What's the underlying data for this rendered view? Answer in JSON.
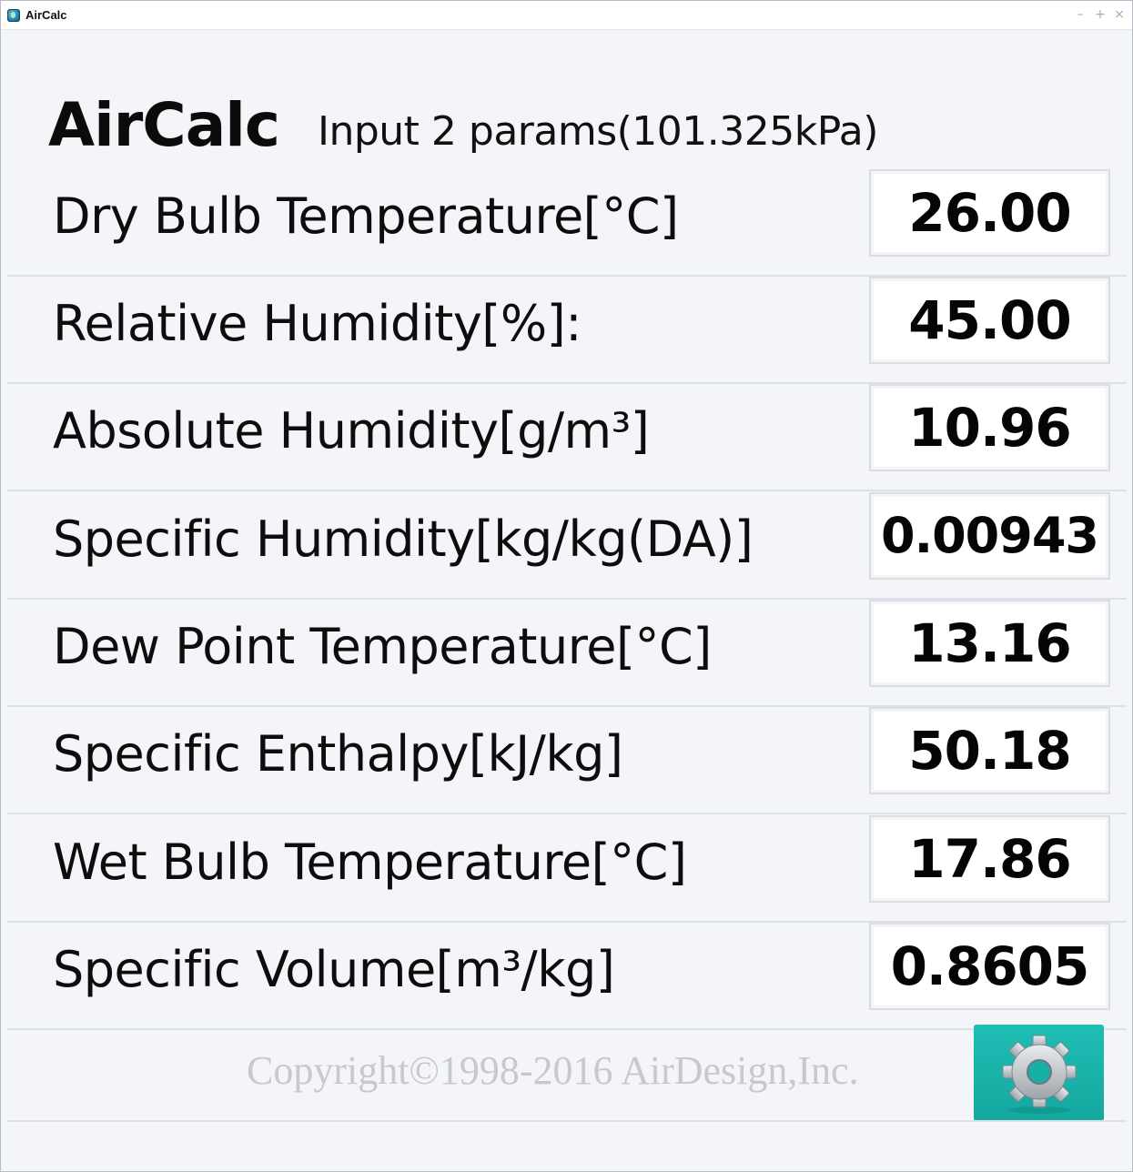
{
  "window": {
    "title": "AirCalc",
    "minimize_glyph": "–",
    "maximize_glyph": "+",
    "close_glyph": "×"
  },
  "header": {
    "app_name": "AirCalc",
    "subtitle": "Input 2 params(101.325kPa)"
  },
  "rows": [
    {
      "label": "Dry Bulb Temperature[°C]",
      "value": "26.00"
    },
    {
      "label": "Relative Humidity[%]:",
      "value": "45.00"
    },
    {
      "label": "Absolute Humidity[g/m³]",
      "value": "10.96"
    },
    {
      "label": "Specific Humidity[kg/kg(DA)]",
      "value": "0.00943"
    },
    {
      "label": "Dew Point Temperature[°C]",
      "value": "13.16"
    },
    {
      "label": "Specific Enthalpy[kJ/kg]",
      "value": "50.18"
    },
    {
      "label": "Wet Bulb Temperature[°C]",
      "value": "17.86"
    },
    {
      "label": "Specific Volume[m³/kg]",
      "value": "0.8605"
    }
  ],
  "footer": {
    "copyright": "Copyright©1998-2016 AirDesign,Inc.",
    "settings_icon": "gear-icon"
  },
  "colors": {
    "settings_button": "#1ab3aa",
    "background": "#f3f5f8"
  }
}
